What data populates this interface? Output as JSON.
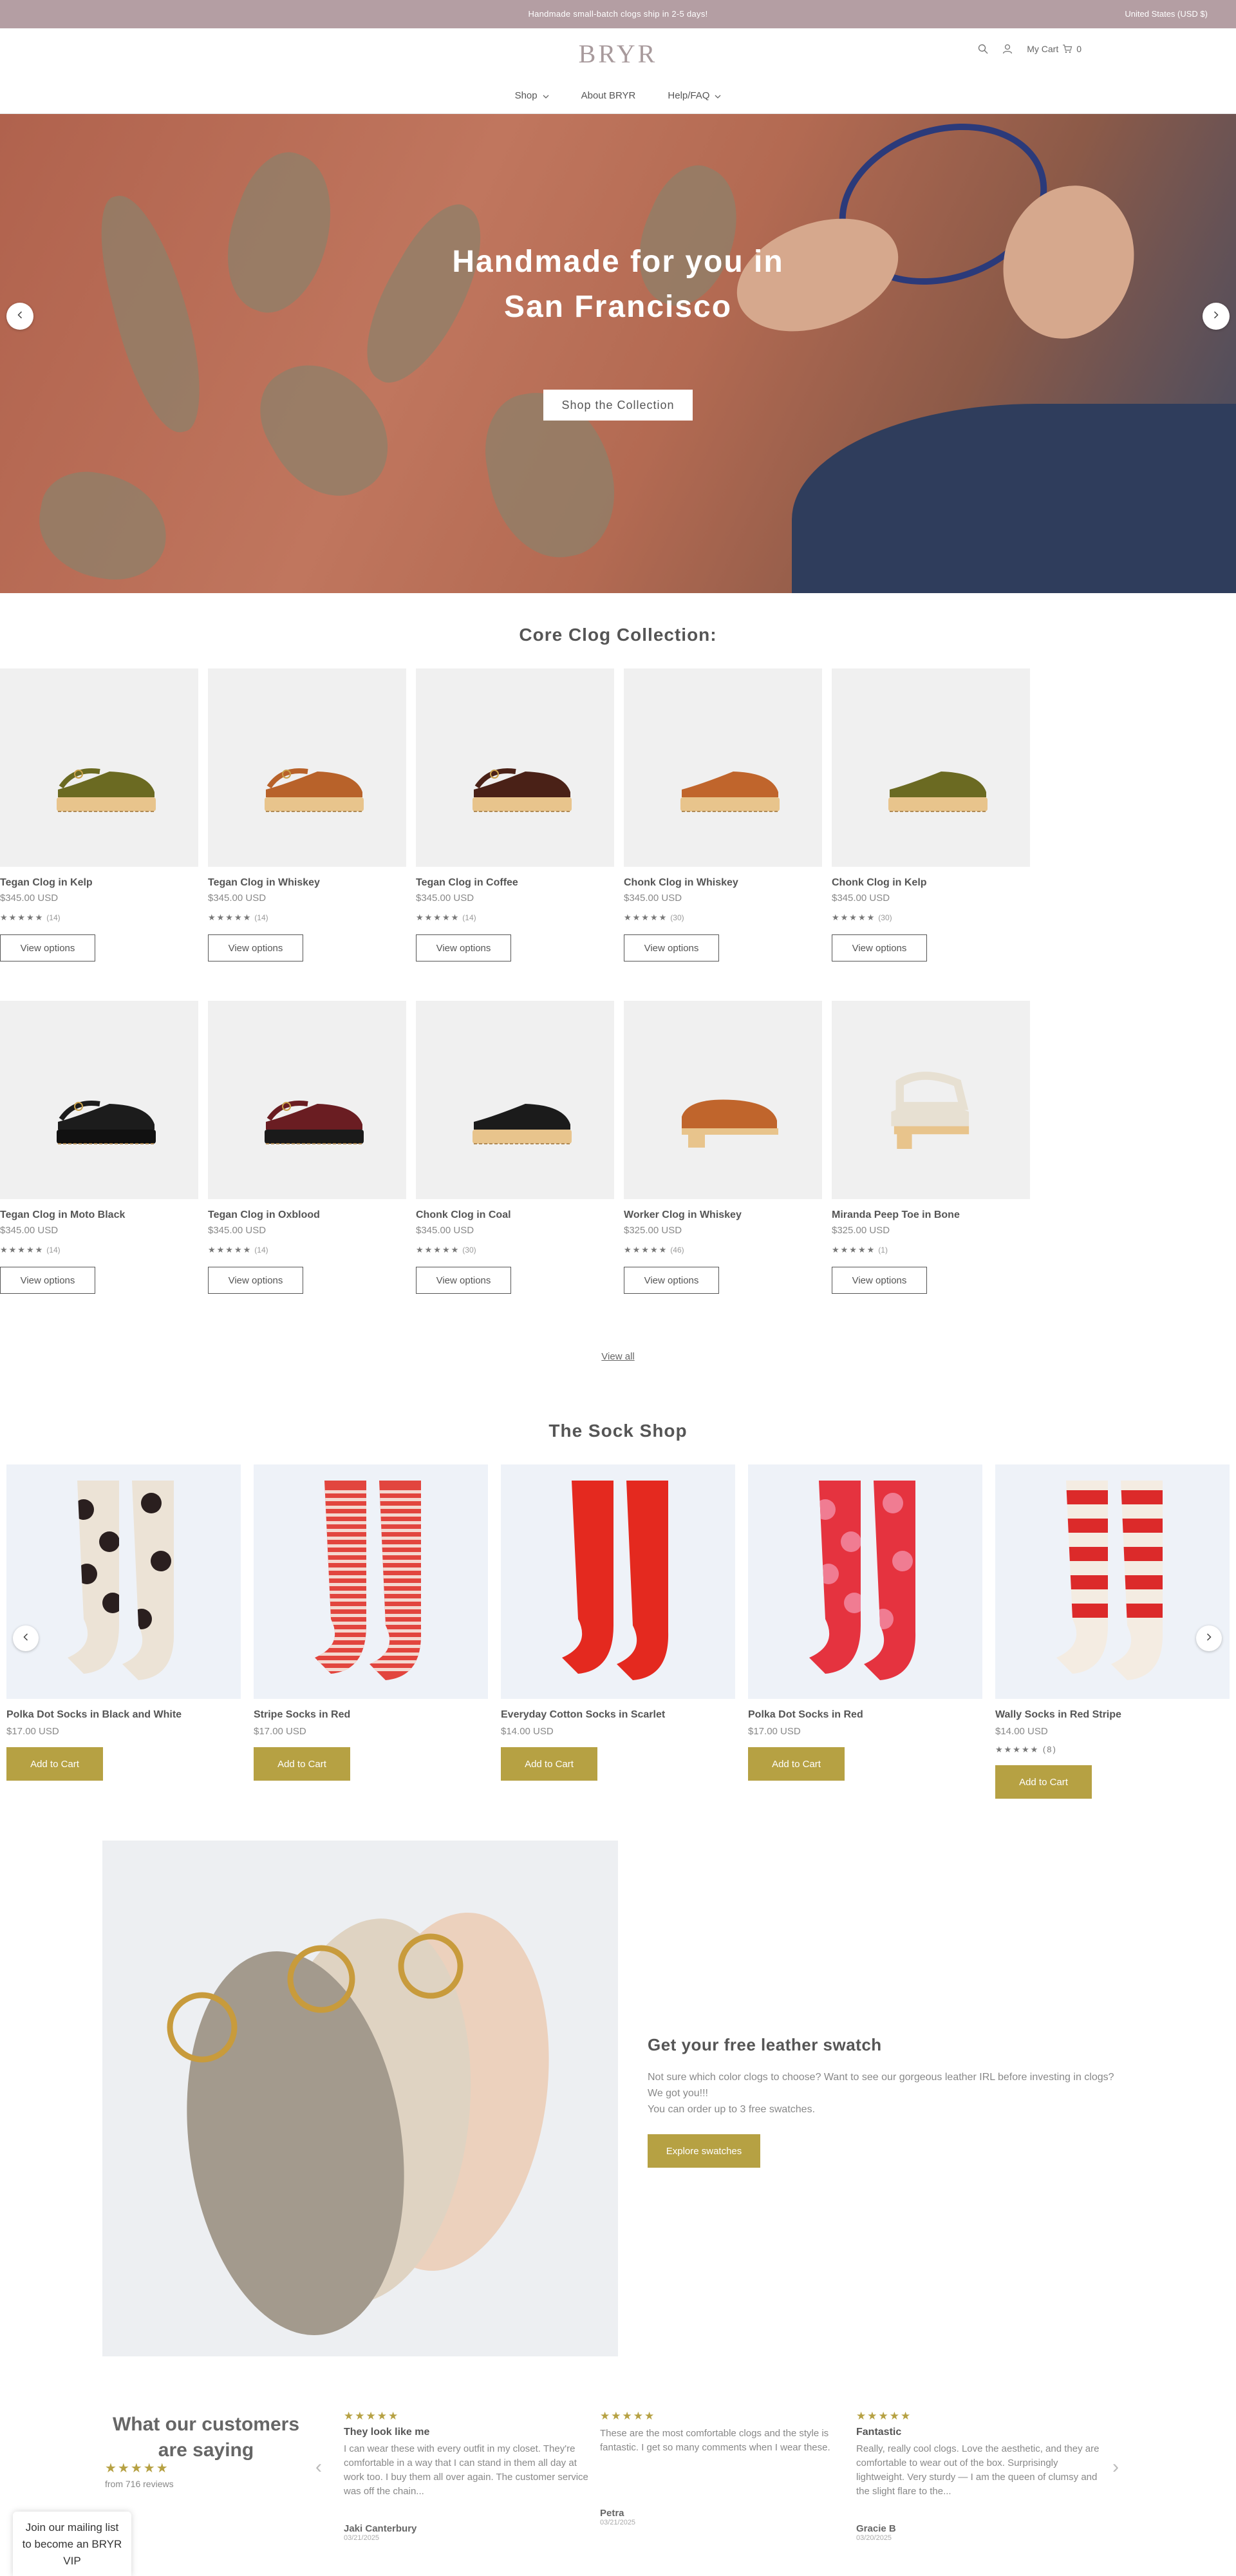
{
  "announcement": {
    "text": "Handmade small-batch clogs ship in 2-5 days!",
    "currency": "United States (USD $)"
  },
  "header": {
    "logo": "BRYR",
    "cart_label": "My Cart",
    "cart_count": "0",
    "nav": [
      {
        "label": "Shop",
        "has_dropdown": true
      },
      {
        "label": "About BRYR",
        "has_dropdown": false
      },
      {
        "label": "Help/FAQ",
        "has_dropdown": true
      }
    ]
  },
  "hero": {
    "headline": "Handmade for you in San Francisco",
    "button": "Shop the Collection"
  },
  "core": {
    "title": "Core Clog Collection:",
    "button_label": "View options",
    "view_all": "View all",
    "products": [
      {
        "name": "Tegan Clog in Kelp",
        "price": "$345.00 USD",
        "stars": "★★★★★",
        "reviews": "(14)",
        "color": "#6b6a22",
        "sole": "#e8c48c",
        "style": "sling"
      },
      {
        "name": "Tegan Clog in Whiskey",
        "price": "$345.00 USD",
        "stars": "★★★★★",
        "reviews": "(14)",
        "color": "#b8622a",
        "sole": "#e8c48c",
        "style": "sling"
      },
      {
        "name": "Tegan Clog in Coffee",
        "price": "$345.00 USD",
        "stars": "★★★★★",
        "reviews": "(14)",
        "color": "#4a2117",
        "sole": "#e8c48c",
        "style": "sling"
      },
      {
        "name": "Chonk Clog in Whiskey",
        "price": "$345.00 USD",
        "stars": "★★★★★",
        "reviews": "(30)",
        "color": "#c0652c",
        "sole": "#e8c48c",
        "style": "mule"
      },
      {
        "name": "Chonk Clog in Kelp",
        "price": "$345.00 USD",
        "stars": "★★★★★",
        "reviews": "(30)",
        "color": "#6b6a22",
        "sole": "#e8c48c",
        "style": "mule"
      },
      {
        "name": "Tegan Clog in Moto Black",
        "price": "$345.00 USD",
        "stars": "★★★★★",
        "reviews": "(14)",
        "color": "#1c1c1c",
        "sole": "#111111",
        "style": "sling"
      },
      {
        "name": "Tegan Clog in Oxblood",
        "price": "$345.00 USD",
        "stars": "★★★★★",
        "reviews": "(14)",
        "color": "#6a1d22",
        "sole": "#1a1a1a",
        "style": "sling"
      },
      {
        "name": "Chonk Clog in Coal",
        "price": "$345.00 USD",
        "stars": "★★★★★",
        "reviews": "(30)",
        "color": "#1b1b1b",
        "sole": "#e8c48c",
        "style": "mule"
      },
      {
        "name": "Worker Clog in Whiskey",
        "price": "$325.00 USD",
        "stars": "★★★★★",
        "reviews": "(46)",
        "color": "#c0652c",
        "sole": "#e8c48c",
        "style": "worker"
      },
      {
        "name": "Miranda Peep Toe in Bone",
        "price": "$325.00 USD",
        "stars": "★★★★★",
        "reviews": "(1)",
        "color": "#e7e0d2",
        "sole": "#e8c48c",
        "style": "peep"
      }
    ]
  },
  "socks": {
    "title": "The Sock Shop",
    "button_label": "Add to Cart",
    "items": [
      {
        "name": "Polka Dot Socks in Black and White",
        "price": "$17.00 USD",
        "base": "#ece3d6",
        "pattern": "#2a1f1f",
        "kind": "dots"
      },
      {
        "name": "Stripe Socks in Red",
        "price": "$17.00 USD",
        "base": "#e2453e",
        "pattern": "#f4d8d0",
        "kind": "stripes"
      },
      {
        "name": "Everyday Cotton Socks in Scarlet",
        "price": "$14.00 USD",
        "base": "#e4291f",
        "pattern": "#e4291f",
        "kind": "plain"
      },
      {
        "name": "Polka Dot Socks in Red",
        "price": "$17.00 USD",
        "base": "#e5333f",
        "pattern": "#f07c92",
        "kind": "dots"
      },
      {
        "name": "Wally Socks in Red Stripe",
        "price": "$14.00 USD",
        "base": "#f4ece2",
        "pattern": "#dc2a2a",
        "kind": "wide",
        "stars": "★★★★★",
        "reviews": "(8)"
      }
    ]
  },
  "swatch": {
    "title": "Get your free leather swatch",
    "body1": "Not sure which color clogs to choose? Want to see our gorgeous leather IRL before investing in clogs? We got you!!!",
    "body2": "You can order up to 3 free swatches.",
    "button": "Explore swatches"
  },
  "reviews": {
    "title": "What our customers are saying",
    "stars": "★★★★★",
    "summary": "from 716 reviews",
    "items": [
      {
        "stars": "★★★★★",
        "title": "They look like me",
        "body": "I can wear these with every outfit in my closet. They're comfortable in a way that I can stand in them all day at work too. I buy them all over again. The customer service was off the chain...",
        "author": "Jaki Canterbury",
        "date": "03/21/2025"
      },
      {
        "stars": "★★★★★",
        "title": "",
        "body": "These are the most comfortable clogs and the style is fantastic. I get so many comments when I wear these.",
        "author": "Petra",
        "date": "03/21/2025"
      },
      {
        "stars": "★★★★★",
        "title": "Fantastic",
        "body": "Really, really cool clogs. Love the aesthetic, and they are comfortable to wear out of the box. Surprisingly lightweight. Very sturdy — I am the queen of clumsy and the slight flare to the...",
        "author": "Gracie B",
        "date": "03/20/2025"
      }
    ]
  },
  "mailing": {
    "text": "Join our mailing list to become an BRYR VIP"
  },
  "colors": {
    "announce_bg": "#b49ea3",
    "accent": "#b6a143",
    "logo": "#a89a9c"
  }
}
